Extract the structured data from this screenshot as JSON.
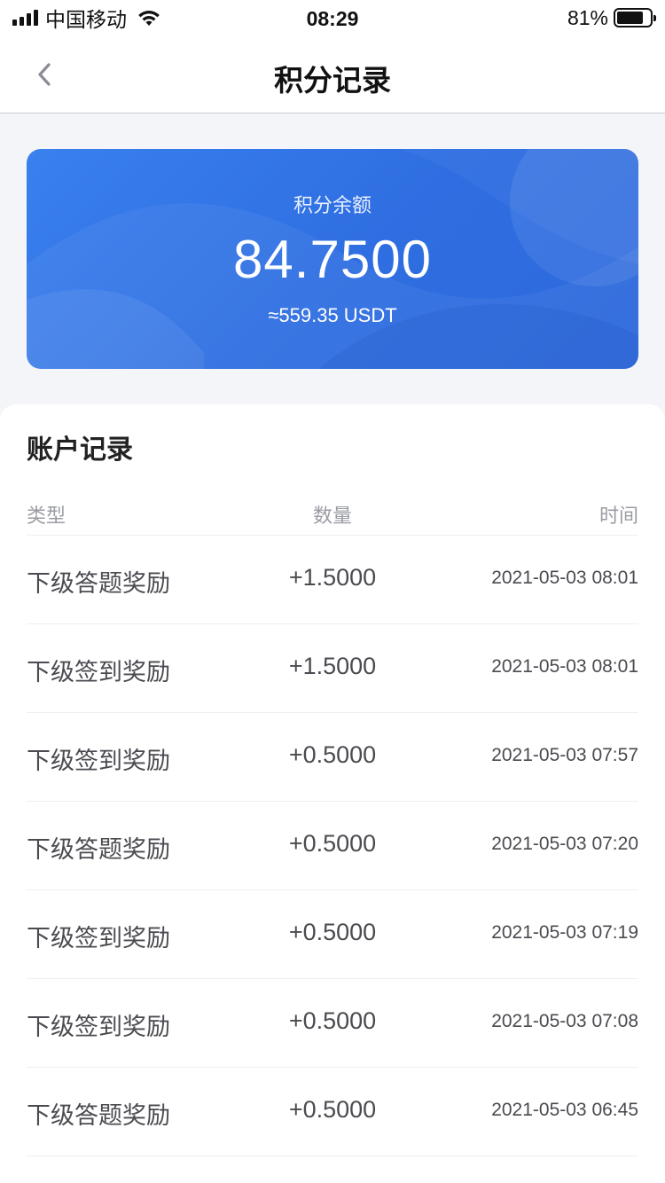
{
  "status_bar": {
    "carrier": "中国移动",
    "time": "08:29",
    "battery_percent": "81%",
    "battery_level": 0.81
  },
  "nav": {
    "title": "积分记录",
    "back_icon": "chevron-left-icon"
  },
  "balance_card": {
    "label": "积分余额",
    "value": "84.7500",
    "usdt": "≈559.35 USDT"
  },
  "records": {
    "title": "账户记录",
    "columns": {
      "type": "类型",
      "amount": "数量",
      "time": "时间"
    },
    "rows": [
      {
        "type": "下级答题奖励",
        "amount": "+1.5000",
        "time": "2021-05-03 08:01"
      },
      {
        "type": "下级签到奖励",
        "amount": "+1.5000",
        "time": "2021-05-03 08:01"
      },
      {
        "type": "下级签到奖励",
        "amount": "+0.5000",
        "time": "2021-05-03 07:57"
      },
      {
        "type": "下级答题奖励",
        "amount": "+0.5000",
        "time": "2021-05-03 07:20"
      },
      {
        "type": "下级签到奖励",
        "amount": "+0.5000",
        "time": "2021-05-03 07:19"
      },
      {
        "type": "下级签到奖励",
        "amount": "+0.5000",
        "time": "2021-05-03 07:08"
      },
      {
        "type": "下级答题奖励",
        "amount": "+0.5000",
        "time": "2021-05-03 06:45"
      }
    ]
  },
  "colors": {
    "card_gradient_start": "#3a80ee",
    "card_gradient_end": "#2c68dc",
    "page_background": "#f4f5f9"
  }
}
